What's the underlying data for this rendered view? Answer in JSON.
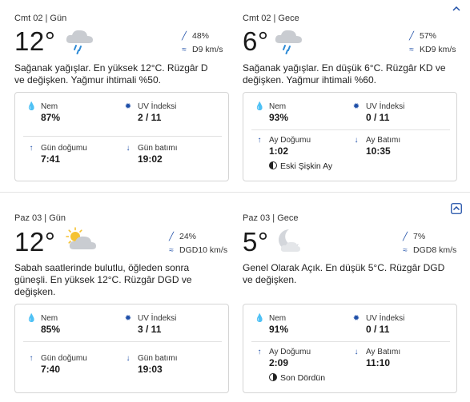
{
  "sections": [
    {
      "day": {
        "label": "Cmt 02 | Gün",
        "temp": "12°",
        "icon": "rain-cloud-icon",
        "precip": "48%",
        "wind": "D9 km/s",
        "summary_lines": [
          "Sağanak yağışlar. En yüksek 12°C. Rüzgâr D",
          "ve değişken. Yağmur ihtimali %50."
        ],
        "humidity_label": "Nem",
        "humidity": "87%",
        "uv_label": "UV İndeksi",
        "uv": "2 / 11",
        "rise_label": "Gün doğumu",
        "rise": "7:41",
        "set_label": "Gün batımı",
        "set": "19:02"
      },
      "night": {
        "label": "Cmt 02 | Gece",
        "temp": "6°",
        "icon": "rain-cloud-icon",
        "precip": "57%",
        "wind": "KD9 km/s",
        "summary_lines": [
          "Sağanak yağışlar. En düşük 6°C. Rüzgâr KD ve",
          "değişken. Yağmur ihtimali %60."
        ],
        "humidity_label": "Nem",
        "humidity": "93%",
        "uv_label": "UV İndeksi",
        "uv": "0 / 11",
        "rise_label": "Ay Doğumu",
        "rise": "1:02",
        "set_label": "Ay Batımı",
        "set": "10:35",
        "moon_phase": "Eski Şişkin Ay"
      }
    },
    {
      "day": {
        "label": "Paz 03 | Gün",
        "temp": "12°",
        "icon": "partly-sunny-icon",
        "precip": "24%",
        "wind": "DGD10 km/s",
        "summary_lines": [
          "Sabah saatlerinde bulutlu, öğleden sonra",
          "güneşli. En yüksek 12°C. Rüzgâr DGD ve",
          "değişken."
        ],
        "humidity_label": "Nem",
        "humidity": "85%",
        "uv_label": "UV İndeksi",
        "uv": "3 / 11",
        "rise_label": "Gün doğumu",
        "rise": "7:40",
        "set_label": "Gün batımı",
        "set": "19:03"
      },
      "night": {
        "label": "Paz 03 | Gece",
        "temp": "5°",
        "icon": "moon-cloud-icon",
        "precip": "7%",
        "wind": "DGD8 km/s",
        "summary_lines": [
          "Genel Olarak Açık. En düşük 5°C. Rüzgâr DGD",
          "ve değişken."
        ],
        "humidity_label": "Nem",
        "humidity": "91%",
        "uv_label": "UV İndeksi",
        "uv": "0 / 11",
        "rise_label": "Ay Doğumu",
        "rise": "2:09",
        "set_label": "Ay Batımı",
        "set": "11:10",
        "moon_phase": "Son Dördün"
      }
    }
  ],
  "colors": {
    "accent": "#1f4fa8",
    "border": "#d5d5d5",
    "text": "#1f1f1f"
  }
}
